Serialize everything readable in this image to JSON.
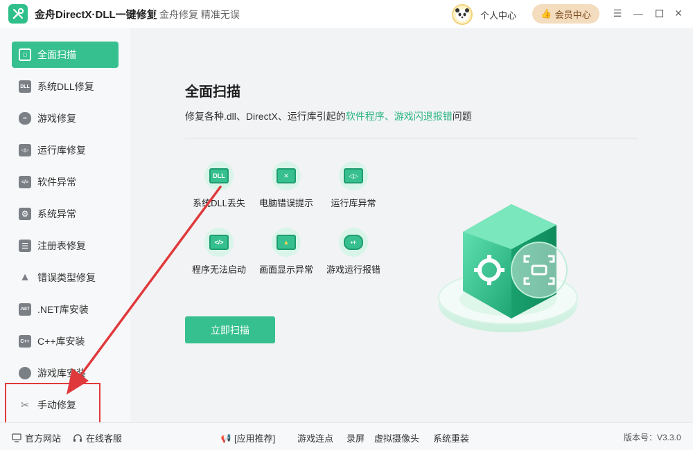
{
  "app": {
    "title": "金舟DirectX·DLL一键修复",
    "slogan": "金舟修复 精准无误",
    "user_center": "个人中心",
    "vip_label": "会员中心"
  },
  "sidebar": {
    "items": [
      {
        "label": "全面扫描",
        "icon": "scan-icon",
        "active": true
      },
      {
        "label": "系统DLL修复",
        "icon": "dll-icon"
      },
      {
        "label": "游戏修复",
        "icon": "gamepad-icon"
      },
      {
        "label": "运行库修复",
        "icon": "runtime-icon"
      },
      {
        "label": "软件异常",
        "icon": "code-icon"
      },
      {
        "label": "系统异常",
        "icon": "gear-icon"
      },
      {
        "label": "注册表修复",
        "icon": "list-icon"
      },
      {
        "label": "错误类型修复",
        "icon": "warning-icon"
      },
      {
        "label": ".NET库安装",
        "icon": "dotnet-icon"
      },
      {
        "label": "C++库安装",
        "icon": "cpp-icon"
      },
      {
        "label": "游戏库安装",
        "icon": "pacman-icon"
      },
      {
        "label": "手动修复",
        "icon": "wrench-icon"
      }
    ]
  },
  "main": {
    "heading": "全面扫描",
    "desc_prefix": "修复各种.dll、DirectX、运行库引起的",
    "desc_highlight": "软件程序、游戏闪退报错",
    "desc_suffix": "问题",
    "features": [
      {
        "label": "系统DLL丢失",
        "icon": "dll-file-icon"
      },
      {
        "label": "电脑错误提示",
        "icon": "error-window-icon"
      },
      {
        "label": "运行库异常",
        "icon": "runtime-window-icon"
      },
      {
        "label": "程序无法启动",
        "icon": "code-window-icon"
      },
      {
        "label": "画面显示异常",
        "icon": "warning-window-icon"
      },
      {
        "label": "游戏运行报错",
        "icon": "gamepad-circle-icon"
      }
    ],
    "scan_button": "立即扫描"
  },
  "bottom": {
    "website": "官方网站",
    "service": "在线客服",
    "recommend": "[应用推荐]",
    "links": [
      "游戏连点",
      "录屏",
      "虚拟摄像头",
      "系统重装"
    ],
    "version": "版本号：V3.3.0"
  },
  "colors": {
    "accent": "#37c08f",
    "highlight_text": "#29b57f",
    "annotation_red": "#e0393b",
    "vip_bg": "#f4dcbf"
  }
}
